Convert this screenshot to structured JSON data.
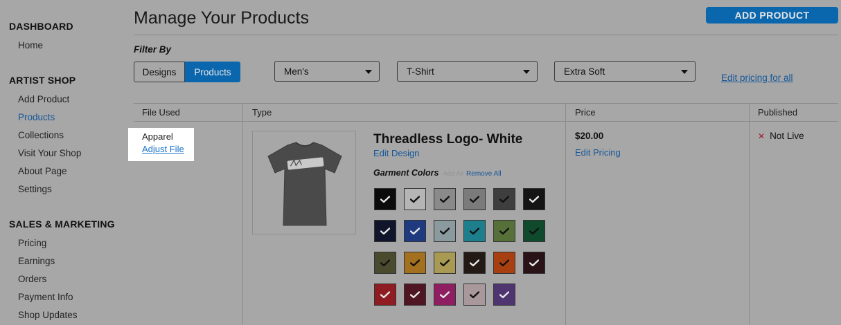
{
  "sidebar": {
    "sections": [
      {
        "heading": "DASHBOARD",
        "items": [
          {
            "label": "Home"
          }
        ]
      },
      {
        "heading": "ARTIST SHOP",
        "items": [
          {
            "label": "Add Product"
          },
          {
            "label": "Products",
            "active": true
          },
          {
            "label": "Collections"
          },
          {
            "label": "Visit Your Shop"
          },
          {
            "label": "About Page"
          },
          {
            "label": "Settings"
          }
        ]
      },
      {
        "heading": "SALES & MARKETING",
        "items": [
          {
            "label": "Pricing"
          },
          {
            "label": "Earnings"
          },
          {
            "label": "Orders"
          },
          {
            "label": "Payment Info"
          },
          {
            "label": "Shop Updates"
          }
        ]
      }
    ]
  },
  "header": {
    "title": "Manage Your Products",
    "add_button": "ADD PRODUCT"
  },
  "filter": {
    "label": "Filter By",
    "toggle": {
      "designs": "Designs",
      "products": "Products",
      "selected": "Products"
    },
    "selects": {
      "gender": "Men's",
      "style": "T-Shirt",
      "fit": "Extra Soft"
    },
    "edit_all_link": "Edit pricing for all"
  },
  "table": {
    "headers": {
      "file": "File Used",
      "type": "Type",
      "price": "Price",
      "published": "Published"
    },
    "row": {
      "file": {
        "label": "Apparel",
        "link": "Adjust File"
      },
      "product_name": "Threadless Logo- White",
      "edit_design": "Edit Design",
      "garment_colors_label": "Garment Colors",
      "add_all": "Add All",
      "remove_all": "Remove All",
      "price": "$20.00",
      "edit_pricing": "Edit Pricing",
      "published_status": "Not Live",
      "published_icon": "x-icon"
    }
  },
  "swatches": [
    {
      "color": "#0b0b0b",
      "check": "#e8e8e8"
    },
    {
      "color": "#b5b5b5",
      "check": "#111111"
    },
    {
      "color": "#8a8a8a",
      "check": "#111111"
    },
    {
      "color": "#7b7b7b",
      "check": "#111111"
    },
    {
      "color": "#3e3e3e",
      "check": "#111111"
    },
    {
      "color": "#141414",
      "check": "#e8e8e8"
    },
    {
      "color": "#10152b",
      "check": "#e8e8e8"
    },
    {
      "color": "#1f3a7e",
      "check": "#e8e8e8"
    },
    {
      "color": "#8a9a9e",
      "check": "#111111"
    },
    {
      "color": "#1d7f8b",
      "check": "#111111"
    },
    {
      "color": "#57703a",
      "check": "#111111"
    },
    {
      "color": "#0f4a2c",
      "check": "#111111"
    },
    {
      "color": "#4a4a2e",
      "check": "#111111"
    },
    {
      "color": "#a2701f",
      "check": "#111111"
    },
    {
      "color": "#a89a52",
      "check": "#111111"
    },
    {
      "color": "#231a16",
      "check": "#e8e8e8"
    },
    {
      "color": "#a83f10",
      "check": "#111111"
    },
    {
      "color": "#2a1316",
      "check": "#e8e8e8"
    },
    {
      "color": "#8f1c23",
      "check": "#e8e8e8"
    },
    {
      "color": "#4f1523",
      "check": "#e8e8e8"
    },
    {
      "color": "#8e1d61",
      "check": "#e8e8e8"
    },
    {
      "color": "#a8979b",
      "check": "#111111"
    },
    {
      "color": "#4f3570",
      "check": "#e8e8e8"
    }
  ],
  "colors": {
    "accent": "#0b67ad",
    "link": "#14579a",
    "overlay": "#a7a7a7"
  }
}
